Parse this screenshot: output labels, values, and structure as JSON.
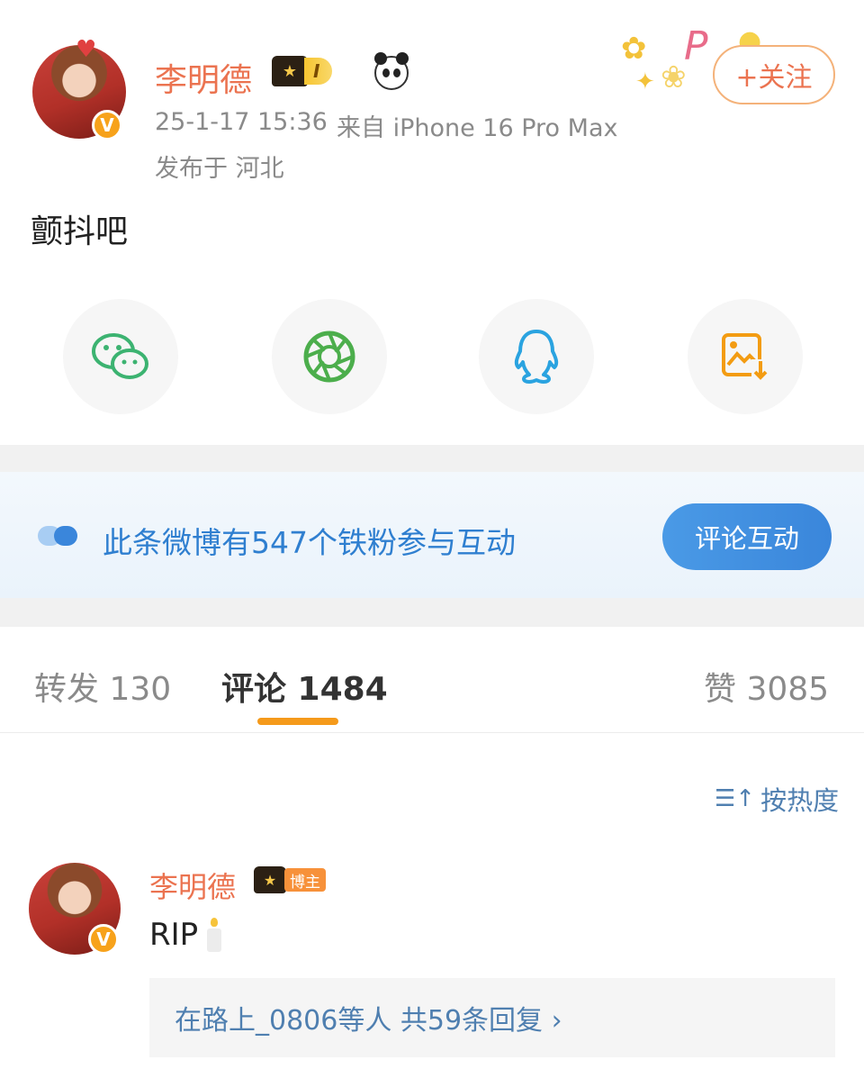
{
  "post": {
    "author": "李明德",
    "level": "I",
    "badge": "V",
    "timestamp": "25-1-17 15:36",
    "source": "来自 iPhone 16 Pro Max",
    "location": "发布于 河北",
    "content": "颤抖吧",
    "follow_label": "+关注"
  },
  "share": {
    "items": [
      {
        "icon": "wechat-icon",
        "color": "#3cb371"
      },
      {
        "icon": "moments-icon",
        "color": "#4cae4c"
      },
      {
        "icon": "qq-icon",
        "color": "#2aa3e0"
      },
      {
        "icon": "save-image-icon",
        "color": "#f39c12"
      }
    ]
  },
  "fans_banner": {
    "text": "此条微博有547个铁粉参与互动",
    "button": "评论互动"
  },
  "tabs": [
    {
      "label": "转发 130"
    },
    {
      "label": "评论 1484"
    },
    {
      "label": "赞 3085"
    }
  ],
  "sort_label": "按热度",
  "comment": {
    "author": "李明德",
    "host_tag": "博主",
    "badge": "V",
    "text": "RIP",
    "replies": "在路上_0806等人  共59条回复 ›"
  },
  "colors": {
    "accent": "#eb7350",
    "link": "#4f7fb0",
    "tab_underline": "#f59a1b",
    "banner_text": "#2f7fd0"
  }
}
